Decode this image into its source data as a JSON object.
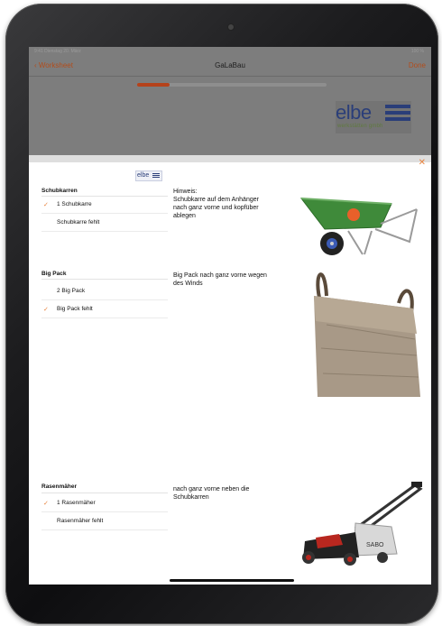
{
  "app": {
    "back_label": "Worksheet",
    "title": "GaLaBau",
    "done_label": "Done",
    "status_left": "9:41  Dienstag 20. März",
    "status_right": "100 %",
    "progress": 0.17
  },
  "logo": {
    "wordmark": "elbe",
    "subtitle": "werkstätten gmbh"
  },
  "modal": {
    "close_symbol": "✕",
    "logo_wordmark": "elbe",
    "sections": [
      {
        "title": "Schubkarren",
        "options": [
          {
            "label": "1 Schubkarre",
            "checked": true
          },
          {
            "label": "Schubkarre fehlt",
            "checked": false
          }
        ],
        "hint_lines": [
          "Hinweis:",
          "Schubkarre auf dem Anhänger",
          "nach ganz vorne und kopfüber",
          "ablegen"
        ],
        "image": "wheelbarrow-image"
      },
      {
        "title": "Big Pack",
        "options": [
          {
            "label": "2 Big Pack",
            "checked": false
          },
          {
            "label": "Big Pack fehlt",
            "checked": true
          }
        ],
        "hint_lines": [
          "Big Pack nach ganz vorne wegen",
          "des Winds"
        ],
        "image": "bigpack-image"
      },
      {
        "title": "Rasenmäher",
        "options": [
          {
            "label": "1 Rasenmäher",
            "checked": true
          },
          {
            "label": "Rasenmäher fehlt",
            "checked": false
          }
        ],
        "hint_lines": [
          "nach ganz vorne neben die",
          "Schubkarren"
        ],
        "image": "lawnmower-image"
      }
    ]
  },
  "colors": {
    "accent": "#e8833f",
    "brand_blue": "#2a3e79",
    "progress": "#b5421b"
  }
}
